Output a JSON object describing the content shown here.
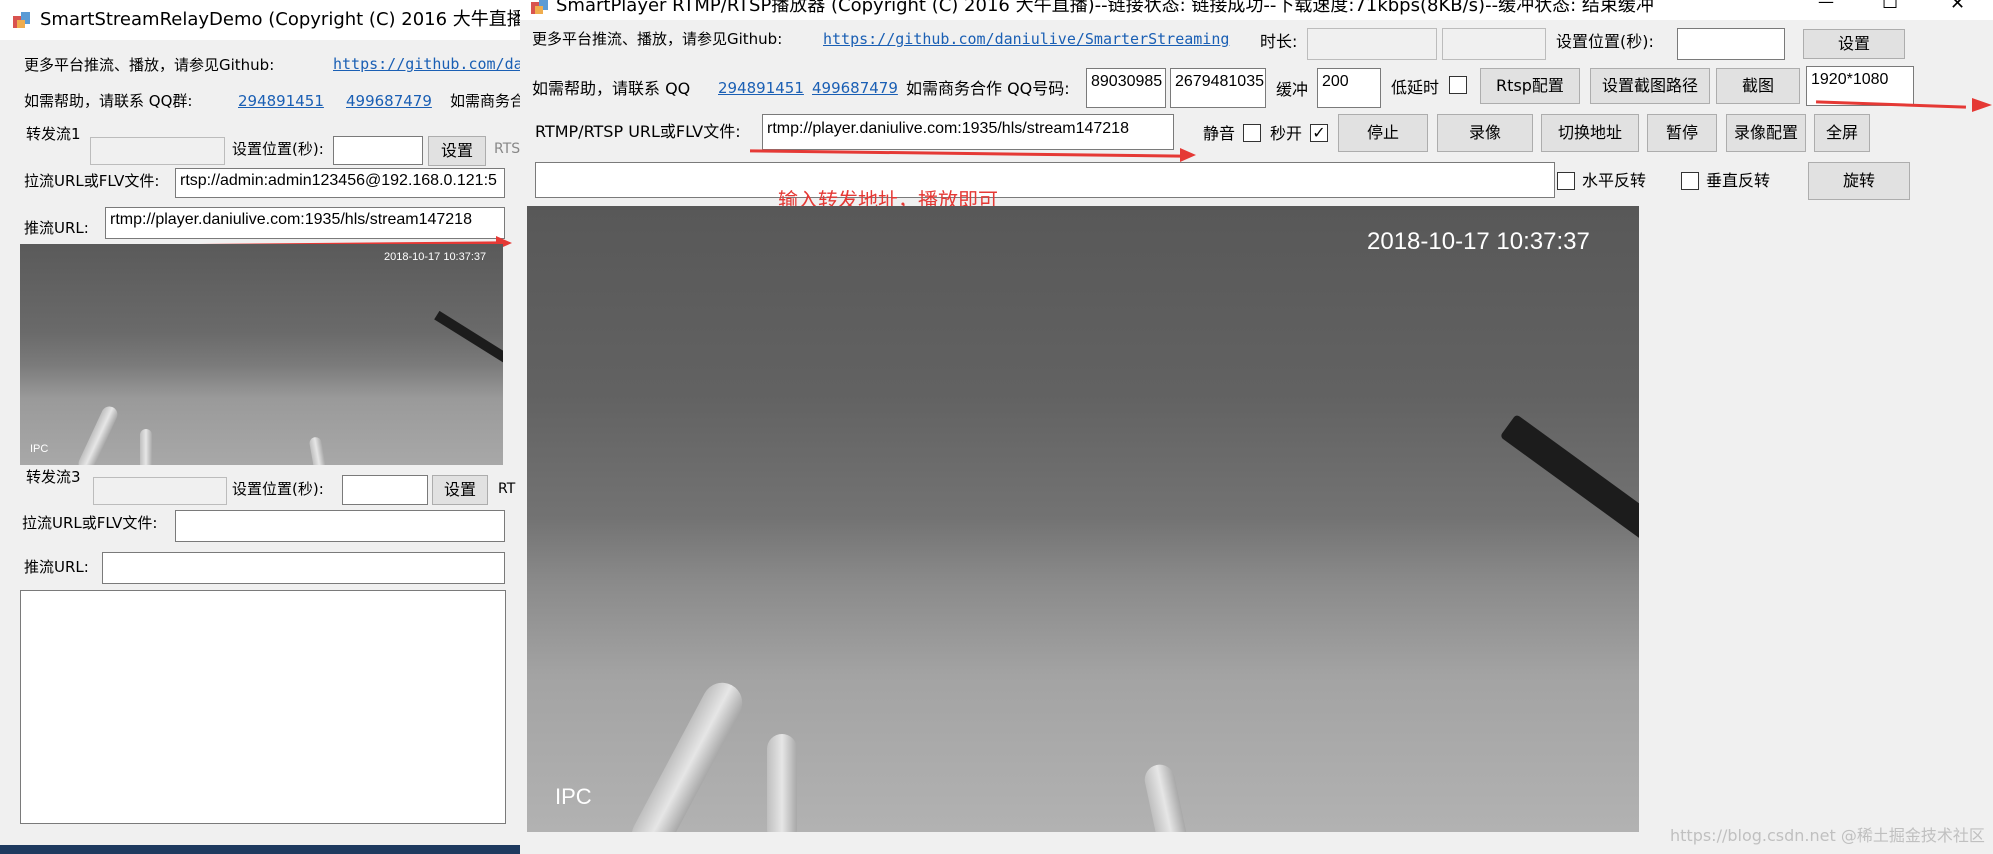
{
  "relay": {
    "title": "SmartStreamRelayDemo  (Copyright (C) 2016 大牛直播)",
    "more_label": "更多平台推流、播放，请参见Github:",
    "github_link": "https://github.com/da",
    "help_label": "如需帮助，请联系 QQ群:",
    "qq1": "294891451",
    "qq2": "499687479",
    "biz_label": "如需商务合",
    "stream1_label": "转发流1",
    "seek_label": "设置位置(秒):",
    "set_btn": "设置",
    "rtsp_cut": "RTS",
    "pull_label": "拉流URL或FLV文件:",
    "pull_value": "rtsp://admin:admin123456@192.168.0.121:5",
    "push_label": "推流URL:",
    "push_value": "rtmp://player.daniulive.com:1935/hls/stream147218",
    "preview_ts": "2018-10-17 10:37:37",
    "preview_ipc": "IPC",
    "stream3_label": "转发流3",
    "seek_label3": "设置位置(秒):",
    "set_btn3": "设置",
    "rt_cut": "RT",
    "pull_label3": "拉流URL或FLV文件:",
    "push_label3": "推流URL:"
  },
  "player": {
    "title": "SmartPlayer RTMP/RTSP播放器 (Copyright (C) 2016 大牛直播)--链接状态: 链接成功--下载速度:71kbps(8KB/s)--缓冲状态: 结束缓冲",
    "more_label": "更多平台推流、播放，请参见Github:",
    "github_link": "https://github.com/daniulive/SmarterStreaming",
    "duration_label": "时长:",
    "seek_label": "设置位置(秒):",
    "set_btn": "设置",
    "help_label": "如需帮助，请联系 QQ",
    "qq1": "294891451",
    "qq2": "499687479",
    "biz_label": "如需商务合作 QQ号码:",
    "biz_qq1": "89030985",
    "biz_qq2": "2679481035",
    "buffer_label": "缓冲",
    "buffer_value": "200",
    "lowlat_label": "低延时",
    "rtsp_cfg_btn": "Rtsp配置",
    "snap_path_btn": "设置截图路径",
    "snap_btn": "截图",
    "resolution": "1920*1080",
    "url_label": "RTMP/RTSP URL或FLV文件:",
    "url_value": "rtmp://player.daniulive.com:1935/hls/stream147218",
    "mute_label": "静音",
    "fast_label": "秒开",
    "stop_btn": "停止",
    "record_btn": "录像",
    "switch_btn": "切换地址",
    "pause_btn": "暂停",
    "rec_cfg_btn": "录像配置",
    "full_btn": "全屏",
    "annotation": "输入转发地址，播放即可",
    "hflip_label": "水平反转",
    "vflip_label": "垂直反转",
    "rotate_btn": "旋转",
    "video_ts": "2018-10-17 10:37:37",
    "video_ipc": "IPC",
    "controls": {
      "close": "✕",
      "minimize": "—",
      "maximize": "☐"
    }
  },
  "watermark": "https://blog.csdn.net  @稀土掘金技术社区"
}
